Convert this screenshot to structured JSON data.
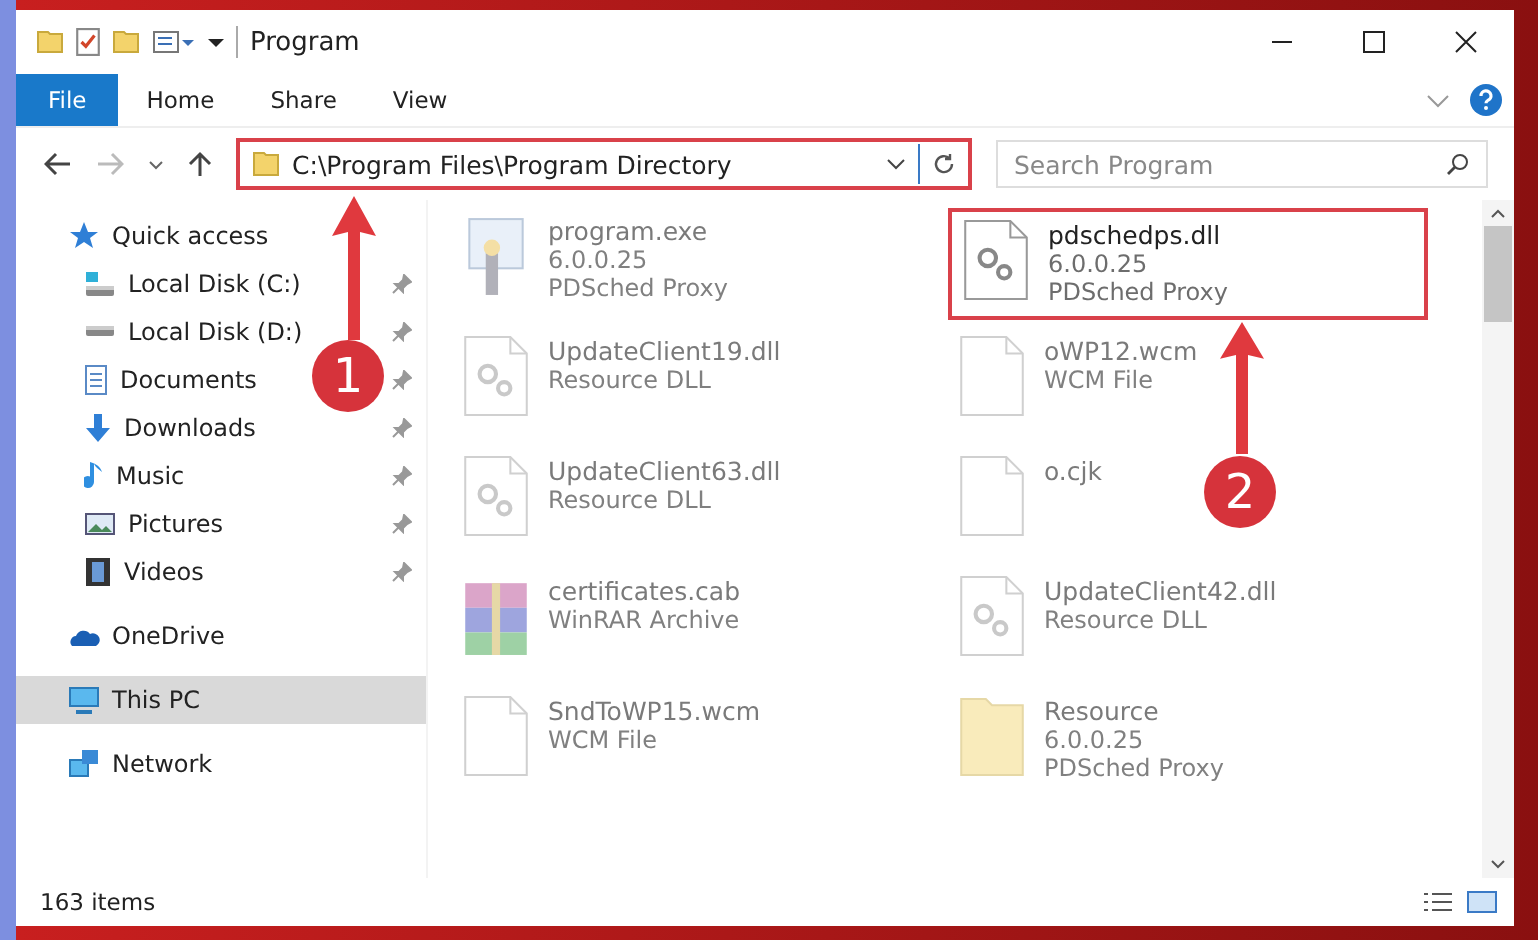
{
  "window": {
    "title": "Program"
  },
  "ribbon_tabs": [
    {
      "label": "File",
      "selected": true
    },
    {
      "label": "Home",
      "selected": false
    },
    {
      "label": "Share",
      "selected": false
    },
    {
      "label": "View",
      "selected": false
    }
  ],
  "address": {
    "path": "C:\\Program Files\\Program Directory",
    "highlighted": true
  },
  "search": {
    "placeholder": "Search Program"
  },
  "sidebar": {
    "items": [
      {
        "label": "Quick access",
        "selected": false,
        "children": [
          {
            "label": "Local Disk (C:)",
            "pinned": true,
            "selected": false
          },
          {
            "label": "Local Disk (D:)",
            "pinned": true,
            "selected": false
          },
          {
            "label": "Documents",
            "pinned": true,
            "selected": false
          },
          {
            "label": "Downloads",
            "pinned": true,
            "selected": false
          },
          {
            "label": "Music",
            "pinned": true,
            "selected": false
          },
          {
            "label": "Pictures",
            "pinned": true,
            "selected": false
          },
          {
            "label": "Videos",
            "pinned": true,
            "selected": false
          }
        ]
      },
      {
        "label": "OneDrive",
        "selected": false
      },
      {
        "label": "This PC",
        "selected": true
      },
      {
        "label": "Network",
        "selected": false
      }
    ]
  },
  "files": [
    {
      "name": "program.exe",
      "lines": [
        "6.0.0.25",
        "PDSched Proxy"
      ],
      "faded": true,
      "highlighted": false
    },
    {
      "name": "pdschedps.dll",
      "lines": [
        "6.0.0.25",
        "PDSched Proxy"
      ],
      "faded": false,
      "highlighted": true
    },
    {
      "name": "UpdateClient19.dll",
      "lines": [
        "Resource DLL"
      ],
      "faded": true,
      "highlighted": false
    },
    {
      "name": "oWP12.wcm",
      "lines": [
        "WCM File"
      ],
      "faded": true,
      "highlighted": false
    },
    {
      "name": "UpdateClient63.dll",
      "lines": [
        "Resource DLL"
      ],
      "faded": true,
      "highlighted": false
    },
    {
      "name": "o.cjk",
      "faded": true,
      "highlighted": false
    },
    {
      "name": "certificates.cab",
      "lines": [
        "WinRAR Archive"
      ],
      "faded": true,
      "highlighted": false
    },
    {
      "name": "UpdateClient42.dll",
      "lines": [
        "Resource DLL"
      ],
      "faded": true,
      "highlighted": false
    },
    {
      "name": "SndToWP15.wcm",
      "lines": [
        "WCM File"
      ],
      "faded": true,
      "highlighted": false
    },
    {
      "name": "Resource",
      "lines": [
        "6.0.0.25",
        "PDSched Proxy"
      ],
      "faded": true,
      "highlighted": false
    }
  ],
  "status_bar": {
    "count": "163 items"
  },
  "annotations": [
    {
      "number": "1"
    },
    {
      "number": "2"
    }
  ]
}
